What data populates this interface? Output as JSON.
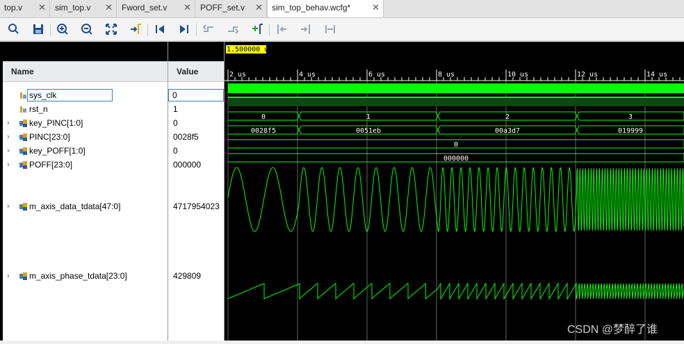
{
  "tabs": [
    {
      "label": "top.v"
    },
    {
      "label": "sim_top.v"
    },
    {
      "label": "Fword_set.v"
    },
    {
      "label": "POFF_set.v"
    },
    {
      "label": "sim_top_behav.wcfg*"
    }
  ],
  "active_tab_index": 4,
  "toolbar_icons": [
    "search-icon",
    "save-icon",
    "zoom-in-icon",
    "zoom-out-icon",
    "zoom-fit-icon",
    "go-to-cursor-icon",
    "go-to-time-zero-icon",
    "go-to-last-time-icon",
    "previous-transition-icon",
    "next-transition-icon",
    "add-marker-icon",
    "previous-marker-icon",
    "next-marker-icon",
    "swap-cursors-icon"
  ],
  "columns": {
    "name": "Name",
    "value": "Value"
  },
  "cursor_time": "1.500000 u",
  "time_ticks": [
    "2 us",
    "4 us",
    "6 us",
    "8 us",
    "10 us",
    "12 us",
    "14 us"
  ],
  "signals": [
    {
      "name": "sys_clk",
      "value": "0",
      "kind": "bit",
      "expandable": false,
      "selected": true
    },
    {
      "name": "rst_n",
      "value": "1",
      "kind": "bit",
      "expandable": false
    },
    {
      "name": "key_PINC[1:0]",
      "value": "0",
      "kind": "bus",
      "expandable": true,
      "segments": [
        {
          "label": "0"
        },
        {
          "label": "1"
        },
        {
          "label": "2"
        },
        {
          "label": "3"
        }
      ]
    },
    {
      "name": "PINC[23:0]",
      "value": "0028f5",
      "kind": "bus",
      "expandable": true,
      "segments": [
        {
          "label": "0028f5"
        },
        {
          "label": "0051eb"
        },
        {
          "label": "00a3d7"
        },
        {
          "label": "019999"
        }
      ]
    },
    {
      "name": "key_POFF[1:0]",
      "value": "0",
      "kind": "bus",
      "expandable": true,
      "segments": [
        {
          "label": "0"
        }
      ]
    },
    {
      "name": "POFF[23:0]",
      "value": "000000",
      "kind": "bus",
      "expandable": true,
      "segments": [
        {
          "label": "000000"
        }
      ]
    },
    {
      "name": "m_axis_data_tdata[47:0]",
      "value": "4717954023",
      "kind": "analog-sine",
      "expandable": true
    },
    {
      "name": "m_axis_phase_tdata[23:0]",
      "value": "429809",
      "kind": "analog-saw",
      "expandable": true
    }
  ],
  "watermark": "CSDN @梦醉了谁",
  "colors": {
    "wave": "#00ff00",
    "cursor_label_bg": "#ffff00",
    "bg": "#000000",
    "grid": "#666666"
  }
}
